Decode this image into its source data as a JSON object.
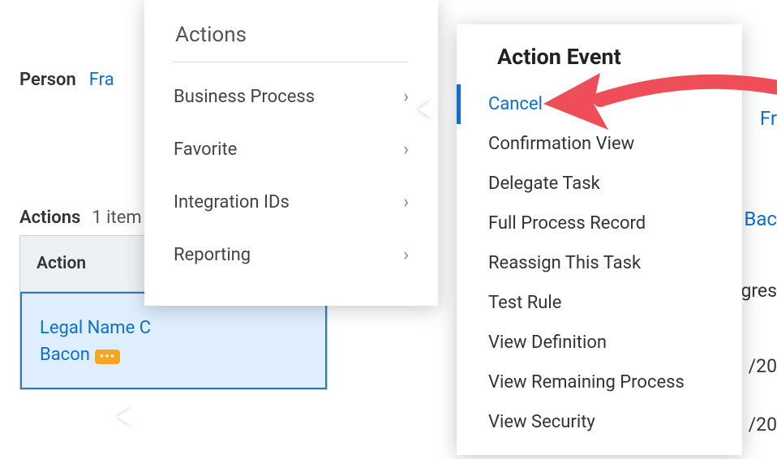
{
  "person": {
    "label": "Person",
    "value": "Fra"
  },
  "actions_section": {
    "label": "Actions",
    "count": "1 item"
  },
  "table": {
    "header": "Action",
    "row": {
      "line1": "Legal Name C",
      "line2": "Bacon"
    }
  },
  "panel1": {
    "title": "Actions",
    "items": [
      "Business Process",
      "Favorite",
      "Integration IDs",
      "Reporting"
    ]
  },
  "panel2": {
    "title": "Action Event",
    "items": [
      "Cancel",
      "Confirmation View",
      "Delegate Task",
      "Full Process Record",
      "Reassign This Task",
      "Test Rule",
      "View Definition",
      "View Remaining Process",
      "View Security"
    ]
  },
  "right_bg": {
    "l1": "Fr",
    "l2": "Bac",
    "l3": "gres",
    "l4": "/20",
    "l5": "/20"
  }
}
